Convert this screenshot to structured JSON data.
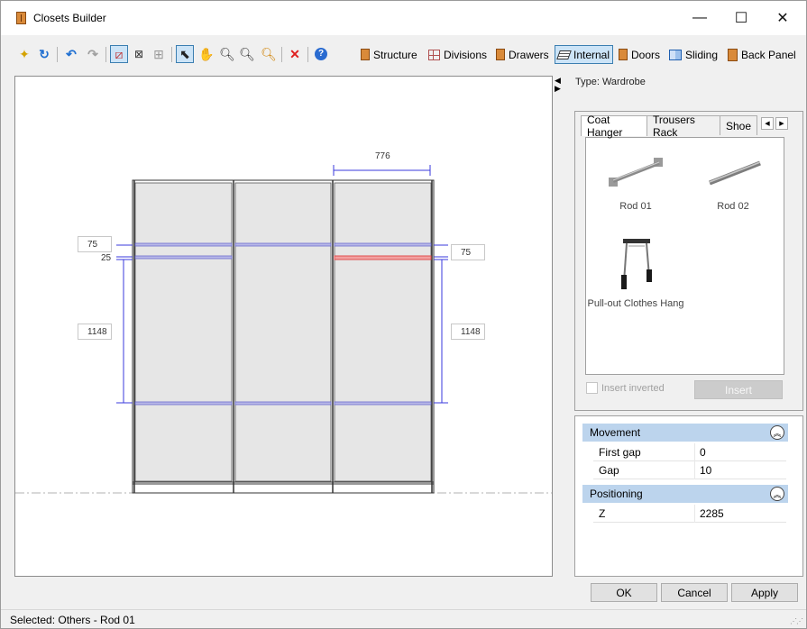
{
  "window": {
    "title": "Closets Builder",
    "minimize": "—",
    "maximize": "☐",
    "close": "✕"
  },
  "toolbar": {
    "icons": [
      "new-icon",
      "reset-icon",
      "undo-icon",
      "redo-icon",
      "edit-shape-icon",
      "dimension-icon",
      "grid-icon",
      "pointer-icon",
      "hand-icon",
      "zoom-in-icon",
      "zoom-out-icon",
      "zoom-fit-icon",
      "delete-icon",
      "help-icon"
    ],
    "modes": {
      "structure": "Structure",
      "divisions": "Divisions",
      "drawers": "Drawers",
      "internal": "Internal",
      "doors": "Doors",
      "sliding": "Sliding",
      "back_panel": "Back Panel"
    },
    "active_mode": "Internal"
  },
  "drawing": {
    "dimensions": {
      "top_width": "776",
      "left_top": "75",
      "left_gap": "25",
      "left_height": "1148",
      "right_top": "75",
      "right_height": "1148"
    },
    "colors": {
      "panel": "#e6e6e6",
      "rod": "#6a6acc",
      "selected_rod": "#e05050",
      "dimension": "#3a3adc"
    }
  },
  "panel": {
    "type_label": "Type: Wardrobe",
    "tabs": [
      "Coat Hanger",
      "Trousers Rack",
      "Shoe"
    ],
    "selected_tab": "Coat Hanger",
    "items": [
      {
        "label": "Rod 01"
      },
      {
        "label": "Rod 02"
      },
      {
        "label": "Pull-out Clothes Hang"
      }
    ],
    "insert_inverted": "Insert inverted",
    "insert_button": "Insert"
  },
  "properties": {
    "movement": {
      "title": "Movement",
      "first_gap_label": "First gap",
      "first_gap_value": "0",
      "gap_label": "Gap",
      "gap_value": "10"
    },
    "positioning": {
      "title": "Positioning",
      "z_label": "Z",
      "z_value": "2285"
    }
  },
  "buttons": {
    "ok": "OK",
    "cancel": "Cancel",
    "apply": "Apply"
  },
  "status": {
    "text": "Selected: Others - Rod 01"
  }
}
